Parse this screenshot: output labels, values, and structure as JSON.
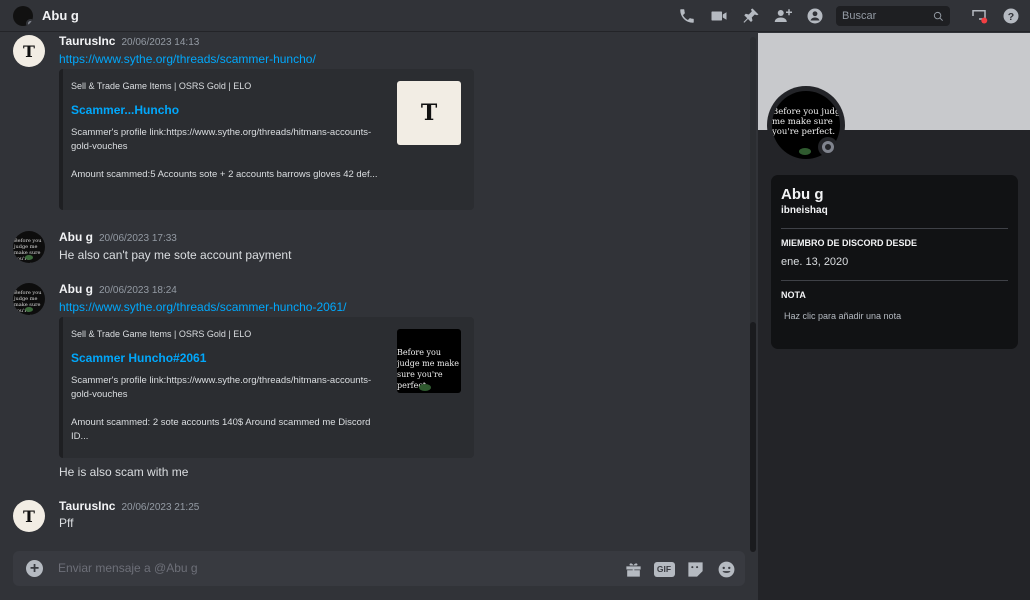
{
  "header": {
    "name": "Abu g",
    "search_placeholder": "Buscar"
  },
  "messages": [
    {
      "author": "TaurusInc",
      "time": "20/06/2023 14:13",
      "link": "https://www.sythe.org/threads/scammer-huncho/",
      "embed": {
        "provider": "Sell & Trade Game Items | OSRS Gold | ELO",
        "title": "Scammer...Huncho",
        "desc1": "Scammer's profile link:https://www.sythe.org/threads/hitmans-accounts-gold-vouches",
        "desc2": "Amount scammed:5 Accounts sote + 2 accounts barrows gloves 42 def..."
      }
    },
    {
      "author": "Abu g",
      "time": "20/06/2023 17:33",
      "text": "He also can't pay me sote account payment"
    },
    {
      "author": "Abu g",
      "time": "20/06/2023 18:24",
      "link": "https://www.sythe.org/threads/scammer-huncho-2061/",
      "embed": {
        "provider": "Sell & Trade Game Items | OSRS Gold | ELO",
        "title": "Scammer Huncho#2061",
        "desc1": "Scammer's profile link:https://www.sythe.org/threads/hitmans-accounts-gold-vouches",
        "desc2": "Amount scammed: 2 sote accounts 140$ Around scammed me Discord ID..."
      },
      "text_after": "He is also scam with me"
    },
    {
      "author": "TaurusInc",
      "time": "20/06/2023 21:25",
      "text": "Pff"
    }
  ],
  "avatars": {
    "taurus_letter": "T",
    "abu_text": "Before you judge me make sure you're perfect."
  },
  "composer": {
    "placeholder": "Enviar mensaje a @Abu g",
    "gif_label": "GIF"
  },
  "profile": {
    "display_name": "Abu g",
    "username": "ibneishaq",
    "member_since_heading": "MIEMBRO DE DISCORD DESDE",
    "member_since": "ene. 13, 2020",
    "note_heading": "NOTA",
    "note_placeholder": "Haz clic para añadir una nota"
  },
  "colors": {
    "background": "#313338",
    "panel": "#232428",
    "link": "#00a8fc"
  }
}
